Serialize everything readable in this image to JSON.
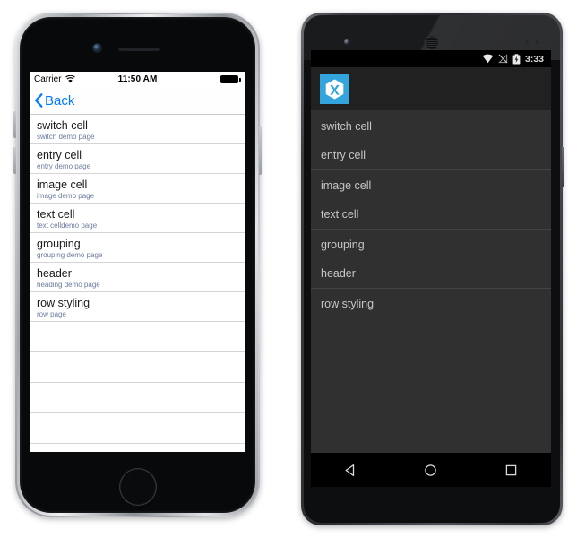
{
  "ios": {
    "status_bar": {
      "carrier": "Carrier",
      "wifi_icon": "wifi-icon",
      "time": "11:50 AM",
      "battery_icon": "battery-full-icon"
    },
    "nav_bar": {
      "back_label": "Back",
      "back_icon": "chevron-left-icon"
    },
    "list": [
      {
        "title": "switch cell",
        "subtitle": "switch demo page"
      },
      {
        "title": "entry cell",
        "subtitle": "entry demo page"
      },
      {
        "title": "image cell",
        "subtitle": "image demo page"
      },
      {
        "title": "text cell",
        "subtitle": "text celldemo page"
      },
      {
        "title": "grouping",
        "subtitle": "grouping demo page"
      },
      {
        "title": "header",
        "subtitle": "heading demo page"
      },
      {
        "title": "row styling",
        "subtitle": "row page"
      }
    ],
    "empty_rows": 4
  },
  "android": {
    "status_bar": {
      "wifi_icon": "wifi-icon",
      "signal_off_icon": "no-signal-icon",
      "battery_icon": "battery-charging-icon",
      "time": "3:33"
    },
    "action_bar": {
      "app_icon": "xamarin-logo-icon"
    },
    "list": [
      {
        "title": "switch cell",
        "divider_after": false
      },
      {
        "title": "entry cell",
        "divider_after": true
      },
      {
        "title": "image cell",
        "divider_after": false
      },
      {
        "title": "text cell",
        "divider_after": true
      },
      {
        "title": "grouping",
        "divider_after": false
      },
      {
        "title": "header",
        "divider_after": true
      },
      {
        "title": "row styling",
        "divider_after": false
      }
    ],
    "nav_bar": {
      "back_icon": "nav-back-triangle-icon",
      "home_icon": "nav-home-circle-icon",
      "recents_icon": "nav-recents-square-icon"
    }
  },
  "colors": {
    "ios_accent": "#007aff",
    "ios_subtitle": "#6b7b9e",
    "android_bg": "#303030",
    "android_actionbar": "#212121",
    "xamarin_blue": "#34a5dc"
  }
}
